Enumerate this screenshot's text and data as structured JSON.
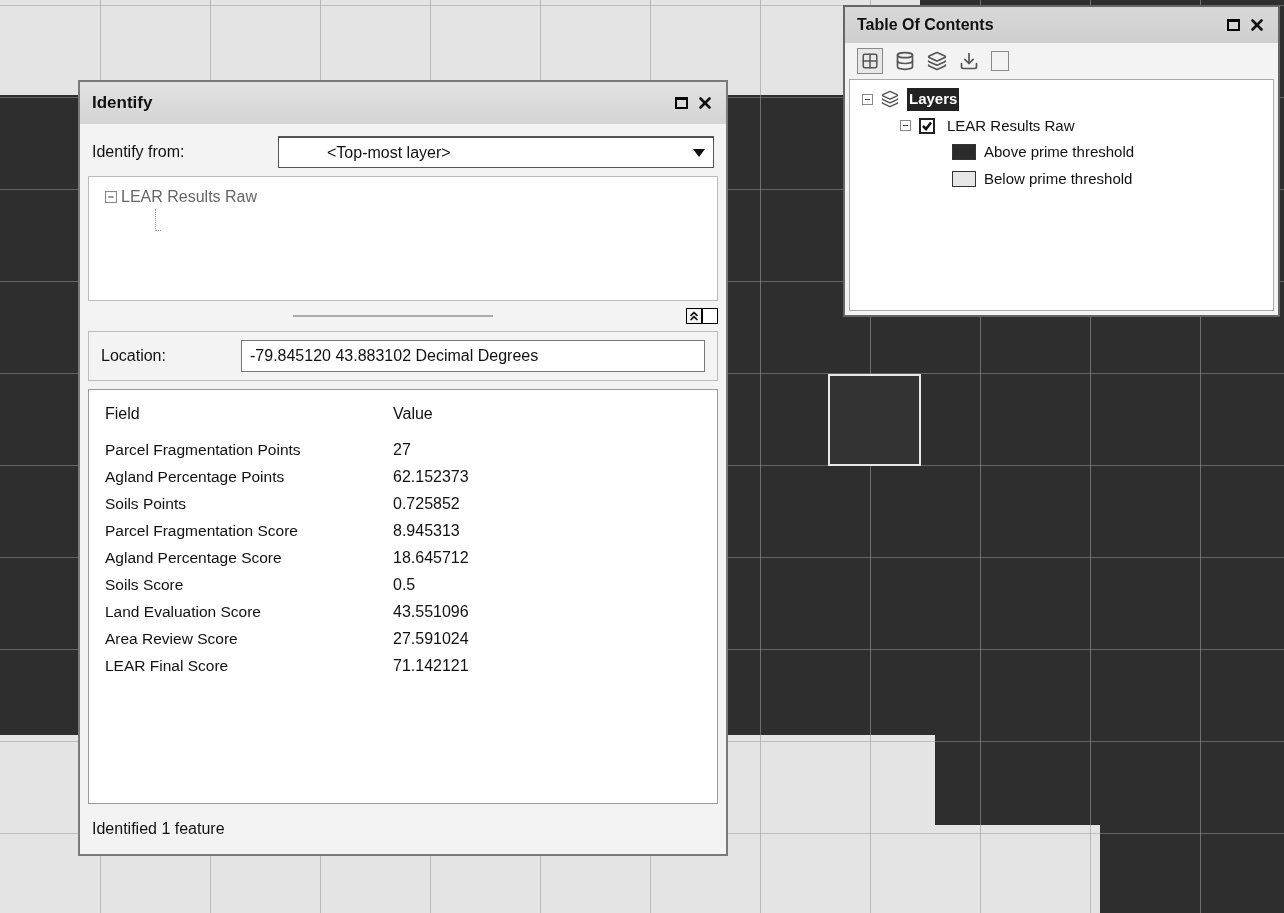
{
  "identify": {
    "title": "Identify",
    "from_label": "Identify from:",
    "from_value": "<Top-most layer>",
    "tree": [
      {
        "label": "LEAR Results Raw",
        "expanded": true
      }
    ],
    "location_label": "Location:",
    "location_value": "-79.845120  43.883102 Decimal Degrees",
    "columns": [
      "Field",
      "Value"
    ],
    "rows": [
      {
        "field": "Parcel Fragmentation Points",
        "value": "27"
      },
      {
        "field": "Agland Percentage Points",
        "value": "62.152373"
      },
      {
        "field": "Soils Points",
        "value": "0.725852"
      },
      {
        "field": "Parcel Fragmentation Score",
        "value": "8.945313"
      },
      {
        "field": "Agland Percentage Score",
        "value": "18.645712"
      },
      {
        "field": "Soils Score",
        "value": "0.5"
      },
      {
        "field": "Land Evaluation Score",
        "value": "43.551096"
      },
      {
        "field": "Area Review Score",
        "value": "27.591024"
      },
      {
        "field": "LEAR Final Score",
        "value": "71.142121"
      }
    ],
    "status": "Identified 1 feature"
  },
  "toc": {
    "title": "Table Of Contents",
    "root": {
      "label": "Layers",
      "selected": true,
      "expanded": true,
      "children": [
        {
          "label": "LEAR Results Raw",
          "checked": true,
          "expanded": true,
          "legend": [
            {
              "label": "Above prime threshold",
              "color": "#2b2b2b"
            },
            {
              "label": "Below prime threshold",
              "color": "#e6e6e6"
            }
          ]
        }
      ]
    }
  }
}
